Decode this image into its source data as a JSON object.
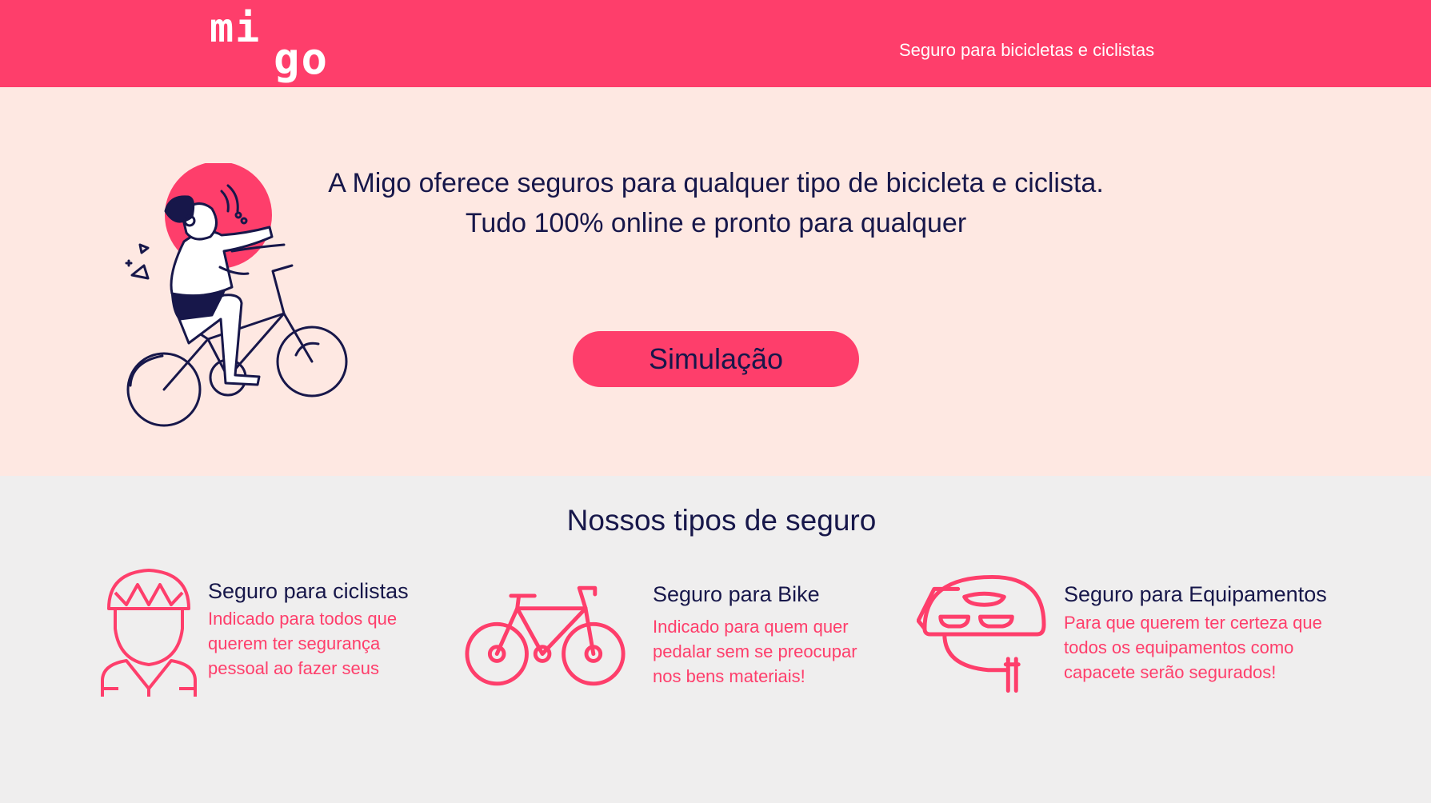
{
  "header": {
    "logo_line1": "mi",
    "logo_line2": "go",
    "tagline": "Seguro para bicicletas e ciclistas"
  },
  "hero": {
    "line1": "A Migo oferece seguros para qualquer tipo de bicicleta e ciclista.",
    "line2": "Tudo 100% online e pronto para qualquer",
    "cta_label": "Simulação",
    "illustration": "woman-riding-bicycle-illustration"
  },
  "insurance": {
    "title": "Nossos tipos de seguro",
    "cards": [
      {
        "icon": "cyclist-helmet-icon",
        "title": "Seguro para ciclistas",
        "desc": [
          "Indicado para todos que",
          "querem ter segurança",
          "pessoal ao fazer seus"
        ]
      },
      {
        "icon": "bicycle-icon",
        "title": "Seguro para Bike",
        "desc": [
          "Indicado para quem quer",
          "pedalar sem se preocupar",
          "nos bens materiais!"
        ]
      },
      {
        "icon": "helmet-icon",
        "title": "Seguro para Equipamentos",
        "desc": [
          "Para que querem ter certeza que",
          "todos os equipamentos como",
          "capacete serão segurados!"
        ]
      }
    ]
  },
  "colors": {
    "brand": "#fe3e6b",
    "hero_bg": "#fee8e2",
    "section_bg": "#efeeee",
    "text_dark": "#17174a"
  }
}
